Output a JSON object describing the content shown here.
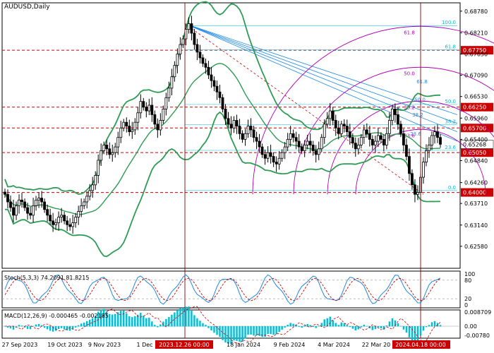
{
  "chart_data": {
    "type": "line",
    "title": "AUDUSD,Daily",
    "colors": {
      "candle": "#000000",
      "bollinger": "#2e9b55",
      "fib_level": "#00bcd4",
      "fan": "#1e88e5",
      "arc": "#b000b0",
      "dashed_level": "#cc0000",
      "trend": "#cc0000",
      "current_box": "#cc0000",
      "macd": "#00bcd4",
      "stoch_main": "#1e88e5"
    },
    "price_axis": {
      "min": 0.62,
      "max": 0.69,
      "ticks": [
        0.6878,
        0.6821,
        0.6765,
        0.6709,
        0.6653,
        0.6597,
        0.654,
        0.6484,
        0.6426,
        0.6371,
        0.6315,
        0.6259
      ]
    },
    "price_labels": [
      {
        "text": "0.68780",
        "value": 0.6878
      },
      {
        "text": "0.68210",
        "value": 0.6821
      },
      {
        "text": "0.67650",
        "value": 0.6765
      },
      {
        "text": "0.67090",
        "value": 0.6709
      },
      {
        "text": "0.66530",
        "value": 0.6653
      },
      {
        "text": "0.65960",
        "value": 0.6596
      },
      {
        "text": "0.65400",
        "value": 0.654
      },
      {
        "text": "0.64840",
        "value": 0.6484
      },
      {
        "text": "0.64260",
        "value": 0.6426
      },
      {
        "text": "0.63710",
        "value": 0.6371
      },
      {
        "text": "0.63140",
        "value": 0.6314
      },
      {
        "text": "0.62580",
        "value": 0.6258
      }
    ],
    "levels": [
      {
        "text": "0.67750",
        "value": 0.6775
      },
      {
        "text": "0.66250",
        "value": 0.6625
      },
      {
        "text": "0.65700",
        "value": 0.657
      },
      {
        "text": "0.65050",
        "value": 0.6505
      },
      {
        "text": "0.64000",
        "value": 0.64
      }
    ],
    "current_price": {
      "text": "0.65268",
      "value": 0.65268
    },
    "fib_labels": [
      {
        "text": "100.0",
        "value": 0.684
      },
      {
        "text": "61.8",
        "value": 0.6776
      },
      {
        "text": "50.0",
        "value": 0.6632
      },
      {
        "text": "38.2",
        "value": 0.6579
      },
      {
        "text": "23.6",
        "value": 0.6511
      },
      {
        "text": "0.0",
        "value": 0.6405
      }
    ],
    "arc_labels": [
      "61.8",
      "50.0",
      "38.2",
      "23.6"
    ],
    "fan_labels": [
      "61.8",
      "50.0",
      "38.2",
      "23.6"
    ],
    "dates": [
      "27 Sep 2023",
      "19 Oct 2023",
      "9 Nov 2023",
      "1 Dec",
      "18 Jan 2024",
      "9 Feb 2024",
      "4 Mar 2024",
      "22 Mar 20",
      "2024.04.18 00:00"
    ],
    "highlight_date": "2023.12.26 00:00",
    "stoch": {
      "label": "Stoch(5,3,3) 74.2091 81.8215",
      "main": 74.2091,
      "signal": 81.8215,
      "axis": [
        "100",
        "80",
        "20",
        "0"
      ]
    },
    "macd": {
      "label": "MACD(12,26,9) -0.000465 -0.002185",
      "main": -0.000465,
      "signal": -0.002185,
      "axis": [
        "0.008709",
        "0.00",
        "-0.00780"
      ]
    },
    "series": [
      {
        "name": "close",
        "values": [
          0.6395,
          0.6375,
          0.636,
          0.634,
          0.6365,
          0.638,
          0.6375,
          0.636,
          0.6345,
          0.634,
          0.6365,
          0.638,
          0.6385,
          0.6375,
          0.6355,
          0.634,
          0.6325,
          0.6315,
          0.632,
          0.6335,
          0.634,
          0.6325,
          0.6315,
          0.631,
          0.632,
          0.6335,
          0.635,
          0.6365,
          0.6375,
          0.639,
          0.6405,
          0.642,
          0.6445,
          0.6485,
          0.651,
          0.6525,
          0.6515,
          0.65,
          0.6505,
          0.652,
          0.6545,
          0.657,
          0.6585,
          0.6575,
          0.656,
          0.6565,
          0.6585,
          0.661,
          0.664,
          0.6625,
          0.6615,
          0.663,
          0.6605,
          0.658,
          0.6565,
          0.659,
          0.662,
          0.665,
          0.6675,
          0.6705,
          0.6735,
          0.6765,
          0.679,
          0.6805,
          0.683,
          0.6845,
          0.682,
          0.679,
          0.677,
          0.6755,
          0.674,
          0.673,
          0.671,
          0.6695,
          0.668,
          0.6665,
          0.665,
          0.662,
          0.6595,
          0.658,
          0.657,
          0.659,
          0.6575,
          0.6555,
          0.654,
          0.6555,
          0.6575,
          0.6565,
          0.6545,
          0.6535,
          0.652,
          0.65,
          0.649,
          0.6505,
          0.6495,
          0.648,
          0.6475,
          0.649,
          0.6505,
          0.652,
          0.654,
          0.6555,
          0.6545,
          0.6535,
          0.652,
          0.651,
          0.6525,
          0.6535,
          0.6525,
          0.651,
          0.65,
          0.6515,
          0.6545,
          0.658,
          0.6595,
          0.6615,
          0.659,
          0.657,
          0.6555,
          0.658,
          0.6575,
          0.656,
          0.6545,
          0.653,
          0.6515,
          0.6525,
          0.6545,
          0.6565,
          0.6555,
          0.654,
          0.6525,
          0.6535,
          0.655,
          0.654,
          0.6525,
          0.6555,
          0.659,
          0.662,
          0.6605,
          0.658,
          0.6555,
          0.6525,
          0.6495,
          0.645,
          0.642,
          0.6395,
          0.64,
          0.644,
          0.648,
          0.651,
          0.6525,
          0.655,
          0.656,
          0.6545,
          0.6527
        ]
      }
    ]
  }
}
